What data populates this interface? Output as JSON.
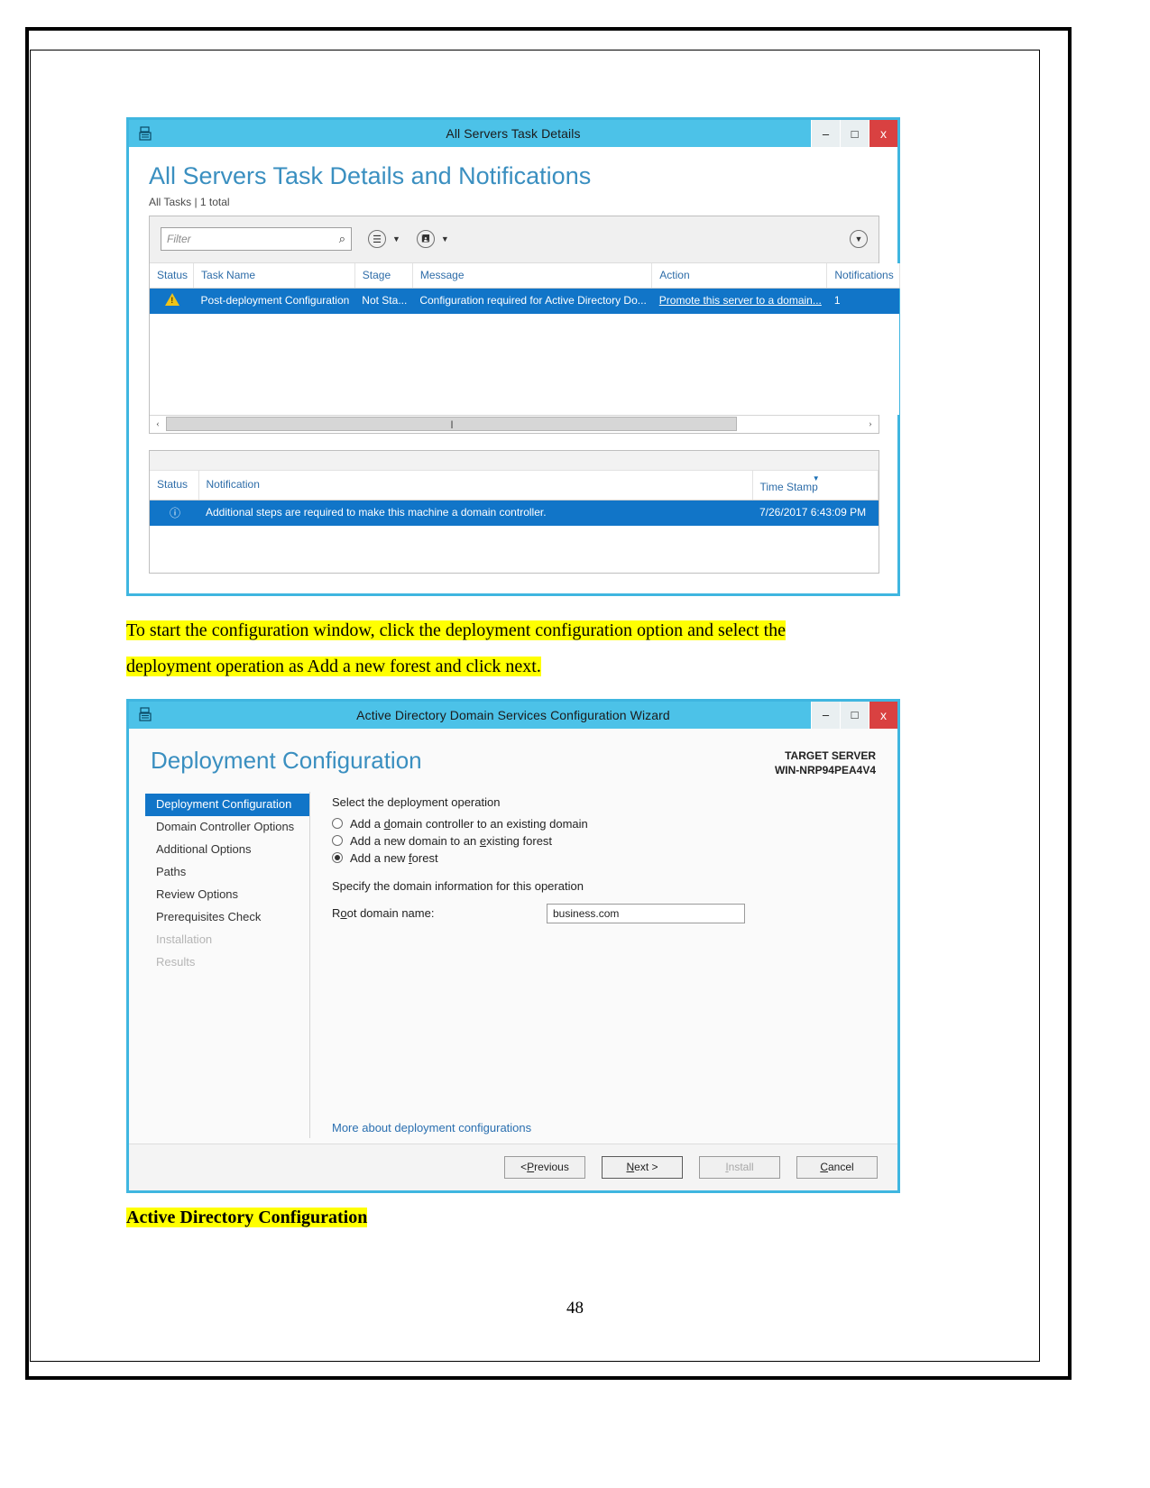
{
  "tasks_window": {
    "title": "All Servers Task Details",
    "icon": "server-manager-icon",
    "buttons": {
      "minimize": "–",
      "maximize": "□",
      "close": "x"
    },
    "heading": "All Servers Task Details and Notifications",
    "subheading": "All Tasks | 1 total",
    "filter": {
      "placeholder": "Filter",
      "value": "",
      "icon": "search-icon"
    },
    "toolbar": {
      "list_icon": "list-filter-icon",
      "save_icon": "save-filter-icon",
      "expander": "chevron-down-icon"
    },
    "tasks_table": {
      "columns": [
        "Status",
        "Task Name",
        "Stage",
        "Message",
        "Action",
        "Notifications"
      ],
      "rows": [
        {
          "status_icon": "warning-icon",
          "task_name": "Post-deployment Configuration",
          "stage": "Not Sta...",
          "message": "Configuration required for Active Directory Do...",
          "action": "Promote this server to a domain...",
          "notifications": "1"
        }
      ]
    },
    "notifications_table": {
      "columns": [
        "Status",
        "Notification",
        "Time Stamp"
      ],
      "sort_column": "Time Stamp",
      "rows": [
        {
          "status_icon": "info-icon",
          "notification": "Additional steps are required to make this machine a domain controller.",
          "time_stamp": "7/26/2017 6:43:09 PM"
        }
      ]
    }
  },
  "body_text": {
    "paragraph_line1": "To start the configuration window, click the deployment configuration option and select the",
    "paragraph_line2": "deployment operation as Add a new forest and click next.",
    "caption": "Active Directory Configuration"
  },
  "wizard_window": {
    "title": "Active Directory Domain Services Configuration Wizard",
    "icon": "server-manager-icon",
    "buttons": {
      "minimize": "–",
      "maximize": "□",
      "close": "x"
    },
    "page_title": "Deployment Configuration",
    "target_server_label": "TARGET SERVER",
    "target_server_name": "WIN-NRP94PEA4V4",
    "nav": [
      {
        "label": "Deployment Configuration",
        "state": "active"
      },
      {
        "label": "Domain Controller Options",
        "state": "enabled"
      },
      {
        "label": "Additional Options",
        "state": "enabled"
      },
      {
        "label": "Paths",
        "state": "enabled"
      },
      {
        "label": "Review Options",
        "state": "enabled"
      },
      {
        "label": "Prerequisites Check",
        "state": "enabled"
      },
      {
        "label": "Installation",
        "state": "disabled"
      },
      {
        "label": "Results",
        "state": "disabled"
      }
    ],
    "operation_label": "Select the deployment operation",
    "operations": [
      {
        "pre": "Add a ",
        "accel": "d",
        "post": "omain controller to an existing domain",
        "selected": false
      },
      {
        "pre": "Add a new domain to an ",
        "accel": "e",
        "post": "xisting forest",
        "selected": false
      },
      {
        "pre": "Add a new ",
        "accel": "f",
        "post": "orest",
        "selected": true
      }
    ],
    "domain_section_label": "Specify the domain information for this operation",
    "root_domain_label_pre": "R",
    "root_domain_label_accel": "o",
    "root_domain_label_post": "ot domain name:",
    "root_domain_value": "business.com",
    "more_link": "More about deployment configurations",
    "footer_buttons": [
      {
        "pre": "< ",
        "accel": "P",
        "post": "revious",
        "state": "enabled"
      },
      {
        "pre": "",
        "accel": "N",
        "post": "ext >",
        "state": "default"
      },
      {
        "pre": "",
        "accel": "I",
        "post": "nstall",
        "state": "disabled"
      },
      {
        "pre": "",
        "accel": "C",
        "post": "ancel",
        "state": "enabled"
      }
    ]
  },
  "page_number": "48"
}
